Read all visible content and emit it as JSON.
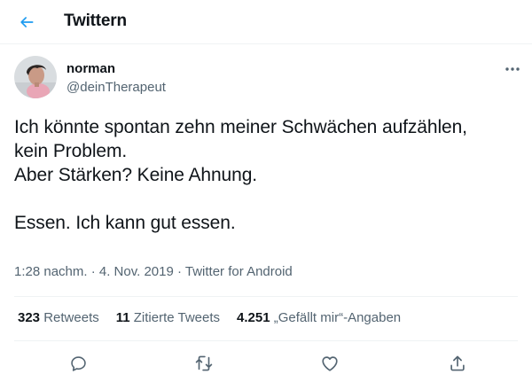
{
  "header": {
    "title": "Twittern",
    "back_icon": "arrow-left-icon"
  },
  "tweet": {
    "author": {
      "name": "norman",
      "handle": "@deinTherapeut"
    },
    "text": "Ich könnte spontan zehn meiner Schwächen aufzählen,\nkein Problem.\nAber Stärken? Keine Ahnung.\n\nEssen. Ich kann gut essen.",
    "meta": "1:28 nachm. · 4. Nov. 2019 · Twitter for Android",
    "stats": {
      "retweets_count": "323",
      "retweets_label": "Retweets",
      "quotes_count": "11",
      "quotes_label": "Zitierte Tweets",
      "likes_count": "4.251",
      "likes_label": "„Gefällt mir“-Angaben"
    },
    "actions": [
      "reply-icon",
      "retweet-icon",
      "like-icon",
      "share-icon"
    ]
  },
  "colors": {
    "accent": "#1d9bf0",
    "text": "#0f1419",
    "secondary": "#536471",
    "divider": "#eff3f4"
  }
}
